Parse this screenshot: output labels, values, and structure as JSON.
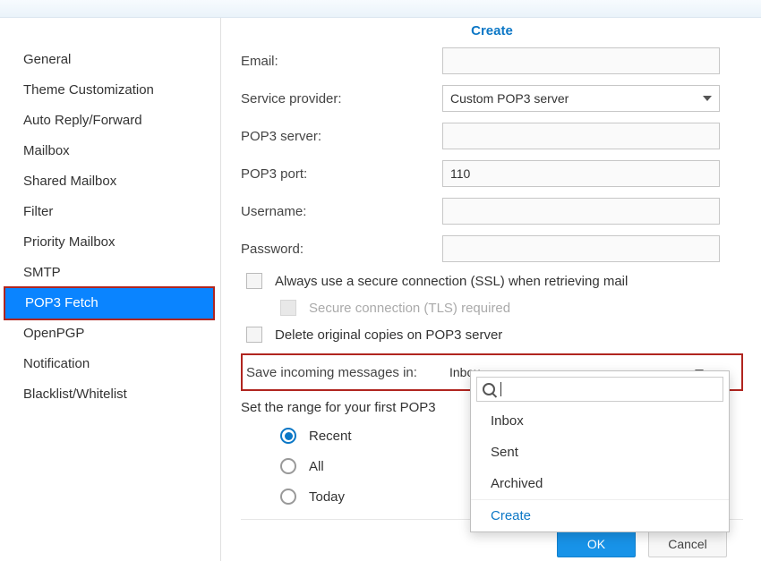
{
  "header": {
    "create": "Create"
  },
  "sidebar": {
    "items": [
      {
        "label": "General"
      },
      {
        "label": "Theme Customization"
      },
      {
        "label": "Auto Reply/Forward"
      },
      {
        "label": "Mailbox"
      },
      {
        "label": "Shared Mailbox"
      },
      {
        "label": "Filter"
      },
      {
        "label": "Priority Mailbox"
      },
      {
        "label": "SMTP"
      },
      {
        "label": "POP3 Fetch"
      },
      {
        "label": "OpenPGP"
      },
      {
        "label": "Notification"
      },
      {
        "label": "Blacklist/Whitelist"
      }
    ]
  },
  "form": {
    "email_label": "Email:",
    "email_value": "",
    "provider_label": "Service provider:",
    "provider_value": "Custom POP3 server",
    "server_label": "POP3 server:",
    "server_value": "",
    "port_label": "POP3 port:",
    "port_value": "110",
    "username_label": "Username:",
    "username_value": "",
    "password_label": "Password:",
    "password_value": "",
    "ssl_label": "Always use a secure connection (SSL) when retrieving mail",
    "tls_label": "Secure connection (TLS) required",
    "delete_label": "Delete original copies on POP3 server",
    "save_label": "Save incoming messages in:",
    "save_value": "Inbox",
    "range_label": "Set the range for your first POP3",
    "radio_recent": "Recent",
    "radio_all": "All",
    "radio_today": "Today"
  },
  "dropdown": {
    "search_placeholder": "",
    "items": [
      {
        "label": "Inbox"
      },
      {
        "label": "Sent"
      },
      {
        "label": "Archived"
      }
    ],
    "create": "Create"
  },
  "buttons": {
    "ok": "OK",
    "cancel": "Cancel"
  }
}
